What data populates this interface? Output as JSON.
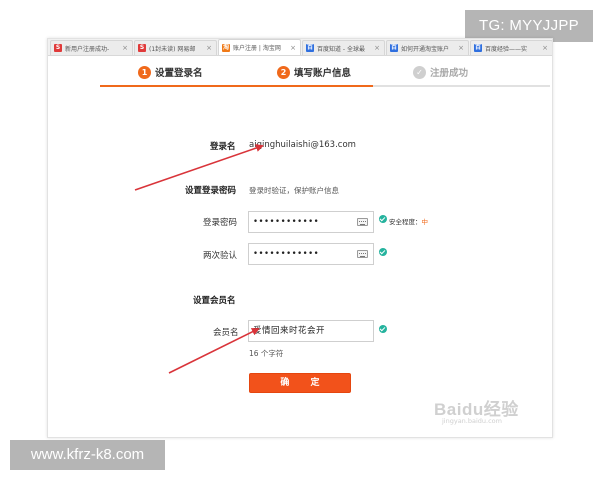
{
  "overlay": {
    "tg_label": "TG: MYYJJPP",
    "url_label": "www.kfrz-k8.com"
  },
  "browser": {
    "tabs": [
      {
        "label": "新用户注册成功-",
        "icon": "red-s-icon"
      },
      {
        "label": "(1封未读) 网易邮",
        "icon": "red-s-icon"
      },
      {
        "label": "账户注册 | 淘宝网",
        "icon": "taobao-icon"
      },
      {
        "label": "百度知道 - 全球最",
        "icon": "baidu-icon"
      },
      {
        "label": "如何开通淘宝账户",
        "icon": "baidu-icon"
      },
      {
        "label": "百度经验——实",
        "icon": "baidu-icon"
      }
    ],
    "tab_close": "×"
  },
  "steps": [
    {
      "num": "1",
      "label": "设置登录名"
    },
    {
      "num": "2",
      "label": "填写账户信息"
    },
    {
      "num": "✓",
      "label": "注册成功"
    }
  ],
  "form": {
    "login_name_label": "登录名",
    "login_name_value": "aiqinghuilaishi@163.com",
    "set_password_title": "设置登录密码",
    "set_password_hint": "登录时验证，保护账户信息",
    "password_label": "登录密码",
    "password_value": "••••••••••••",
    "strength_label": "安全程度：",
    "strength_level": "中",
    "confirm_label": "两次验认",
    "confirm_value": "••••••••••••",
    "member_title": "设置会员名",
    "member_label": "会员名",
    "member_value": "爱情回来时花会开",
    "member_count": "16 个字符",
    "submit_label": "确 定"
  },
  "watermark": {
    "brand": "Baidu经验",
    "sub": "jingyan.baidu.com"
  },
  "colors": {
    "accent": "#f0691b",
    "submit": "#f2521b",
    "ok": "#25b39e",
    "arrow": "#d9343a"
  }
}
